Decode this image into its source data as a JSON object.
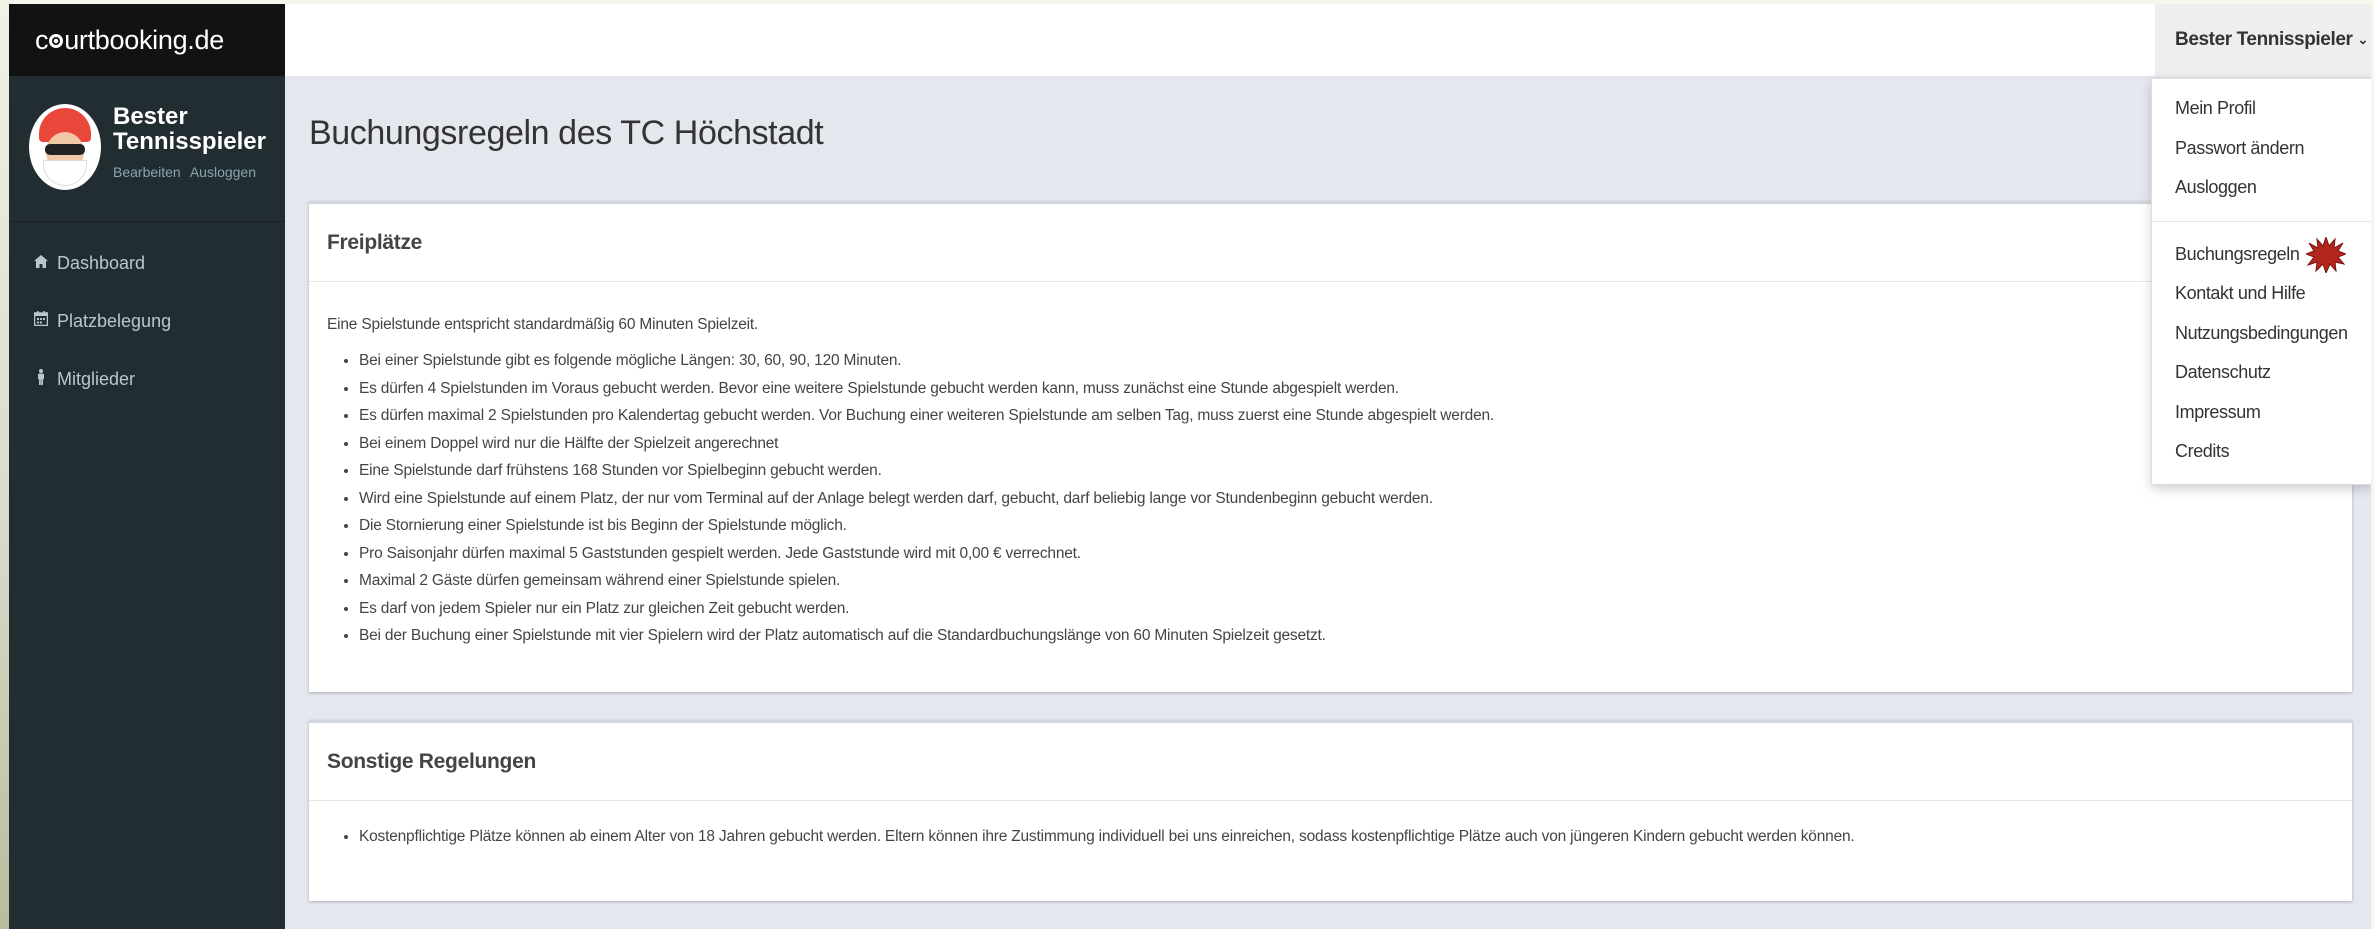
{
  "brand": {
    "prefix": "c",
    "suffix": "urtbooking.de"
  },
  "user": {
    "name": "Bester Tennisspieler",
    "edit_label": "Bearbeiten",
    "logout_label": "Ausloggen"
  },
  "sidebar": {
    "items": [
      {
        "label": "Dashboard",
        "icon": "home-icon"
      },
      {
        "label": "Platzbelegung",
        "icon": "calendar-icon"
      },
      {
        "label": "Mitglieder",
        "icon": "person-icon"
      }
    ]
  },
  "header": {
    "user_menu_label": "Bester Tennisspieler",
    "caret": "⌄"
  },
  "dropdown": {
    "group1": [
      "Mein Profil",
      "Passwort ändern",
      "Ausloggen"
    ],
    "group2": [
      "Buchungsregeln",
      "Kontakt und Hilfe",
      "Nutzungsbedingungen",
      "Datenschutz",
      "Impressum",
      "Credits"
    ]
  },
  "page": {
    "title": "Buchungsregeln des TC Höchstadt"
  },
  "box1": {
    "title": "Freiplätze",
    "intro": "Eine Spielstunde entspricht standardmäßig 60 Minuten Spielzeit.",
    "rules": [
      "Bei einer Spielstunde gibt es folgende mögliche Längen: 30, 60, 90, 120 Minuten.",
      "Es dürfen 4 Spielstunden im Voraus gebucht werden. Bevor eine weitere Spielstunde gebucht werden kann, muss zunächst eine Stunde abgespielt werden.",
      "Es dürfen maximal 2 Spielstunden pro Kalendertag gebucht werden. Vor Buchung einer weiteren Spielstunde am selben Tag, muss zuerst eine Stunde abgespielt werden.",
      "Bei einem Doppel wird nur die Hälfte der Spielzeit angerechnet",
      "Eine Spielstunde darf frühstens 168 Stunden vor Spielbeginn gebucht werden.",
      "Wird eine Spielstunde auf einem Platz, der nur vom Terminal auf der Anlage belegt werden darf, gebucht, darf beliebig lange vor Stundenbeginn gebucht werden.",
      "Die Stornierung einer Spielstunde ist bis Beginn der Spielstunde möglich.",
      "Pro Saisonjahr dürfen maximal 5 Gaststunden gespielt werden. Jede Gaststunde wird mit 0,00 € verrechnet.",
      "Maximal 2 Gäste dürfen gemeinsam während einer Spielstunde spielen.",
      "Es darf von jedem Spieler nur ein Platz zur gleichen Zeit gebucht werden.",
      "Bei der Buchung einer Spielstunde mit vier Spielern wird der Platz automatisch auf die Standardbuchungslänge von 60 Minuten Spielzeit gesetzt."
    ]
  },
  "box2": {
    "title": "Sonstige Regelungen",
    "rules": [
      "Kostenpflichtige Plätze können ab einem Alter von 18 Jahren gebucht werden. Eltern können ihre Zustimmung individuell bei uns einreichen, sodass kostenpflichtige Plätze auch von jüngeren Kindern gebucht werden können."
    ]
  },
  "colors": {
    "sidebar": "#222d32",
    "brand_bg": "#121212",
    "content_bg": "#e4e8ee",
    "click_marker": "#b3261e"
  }
}
